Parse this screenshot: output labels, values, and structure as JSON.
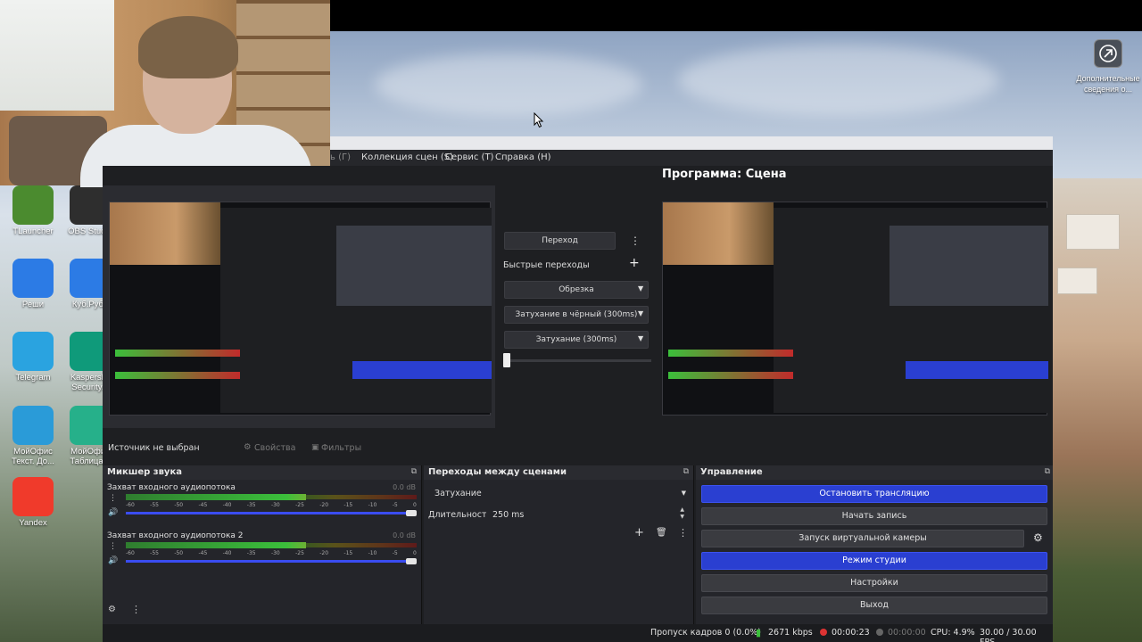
{
  "desktop": {
    "icons": [
      {
        "label": "TLauncher",
        "color": "#4b8b2f"
      },
      {
        "label": "OBS Studio",
        "color": "#2e2e2e"
      },
      {
        "label": "Реши",
        "color": "#2c7be5"
      },
      {
        "label": "Куб.Рубл",
        "color": "#2c7be5"
      },
      {
        "label": "Telegram",
        "color": "#2aa3e0"
      },
      {
        "label": "Kaspersky Security...",
        "color": "#0f9a7a"
      },
      {
        "label": "МойОфис Текст. До...",
        "color": "#2a9bd8"
      },
      {
        "label": "МойОфис Таблица...",
        "color": "#26b08a"
      },
      {
        "label": "Yandex",
        "color": "#f03a2b"
      }
    ],
    "corner_widget": {
      "icon": "settings-icon",
      "text1": "Дополнительные",
      "text2": "сведения о..."
    }
  },
  "obs": {
    "menu": [
      "ь (Г)",
      "Коллекция сцен (S)",
      "Сервис (T)",
      "Справка (H)"
    ],
    "program_title": "Программа: Сцена",
    "transitions_mid": {
      "transition_btn": "Переход",
      "quick_label": "Быстрые переходы",
      "items": [
        "Обрезка",
        "Затухание в чёрный (300ms)",
        "Затухание (300ms)"
      ]
    },
    "source_bar": {
      "no_source": "Источник не выбран",
      "properties": "Свойства",
      "filters": "Фильтры"
    },
    "mixer": {
      "title": "Микшер звука",
      "channels": [
        {
          "name": "Захват входного аудиопотока",
          "db": "0.0 dB",
          "level": 0.62
        },
        {
          "name": "Захват входного аудиопотока 2",
          "db": "0.0 dB",
          "level": 0.62
        }
      ],
      "scale": [
        "-60",
        "-55",
        "-50",
        "-45",
        "-40",
        "-35",
        "-30",
        "-25",
        "-20",
        "-15",
        "-10",
        "-5",
        "0"
      ]
    },
    "scene_transitions": {
      "title": "Переходы между сценами",
      "selected": "Затухание",
      "duration_label": "Длительность",
      "duration_value": "250 ms"
    },
    "controls": {
      "title": "Управление",
      "buttons": [
        {
          "label": "Остановить трансляцию",
          "active": true
        },
        {
          "label": "Начать запись",
          "active": false
        },
        {
          "label": "Запуск виртуальной камеры",
          "active": false
        },
        {
          "label": "Режим студии",
          "active": true
        },
        {
          "label": "Настройки",
          "active": false
        },
        {
          "label": "Выход",
          "active": false
        }
      ]
    },
    "status": {
      "dropped": "Пропуск кадров 0 (0.0%)",
      "bitrate": "2671 kbps",
      "live_time": "00:00:23",
      "rec_time": "00:00:00",
      "cpu": "CPU: 4.9%",
      "fps": "30.00 / 30.00 FPS"
    }
  }
}
